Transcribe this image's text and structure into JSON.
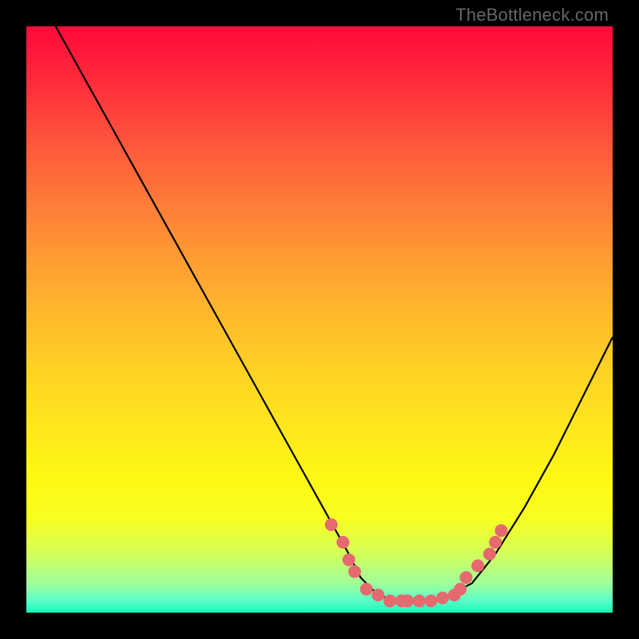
{
  "watermark": "TheBottleneck.com",
  "colors": {
    "background": "#000000",
    "curve": "#000000",
    "markers": "#e46a6f",
    "gradient_top": "#ff0a3a",
    "gradient_bottom": "#15f7b4"
  },
  "chart_data": {
    "type": "line",
    "title": "",
    "xlabel": "",
    "ylabel": "",
    "xlim": [
      0,
      100
    ],
    "ylim": [
      0,
      100
    ],
    "series": [
      {
        "name": "bottleneck-curve",
        "x": [
          5,
          10,
          15,
          20,
          25,
          30,
          35,
          40,
          45,
          50,
          55,
          57,
          60,
          63,
          65,
          68,
          72,
          76,
          80,
          85,
          90,
          95,
          100
        ],
        "y": [
          100,
          91,
          82,
          73,
          64,
          55,
          46,
          37,
          28,
          19,
          10,
          6,
          3,
          2,
          2,
          2,
          3,
          5,
          10,
          18,
          27,
          37,
          47
        ]
      }
    ],
    "markers": {
      "name": "highlight-points",
      "x": [
        52,
        54,
        55,
        56,
        58,
        60,
        62,
        64,
        65,
        67,
        69,
        71,
        73,
        74,
        75,
        77,
        79,
        80,
        81
      ],
      "y": [
        15,
        12,
        9,
        7,
        4,
        3,
        2,
        2,
        2,
        2,
        2,
        2.5,
        3,
        4,
        6,
        8,
        10,
        12,
        14
      ]
    }
  }
}
